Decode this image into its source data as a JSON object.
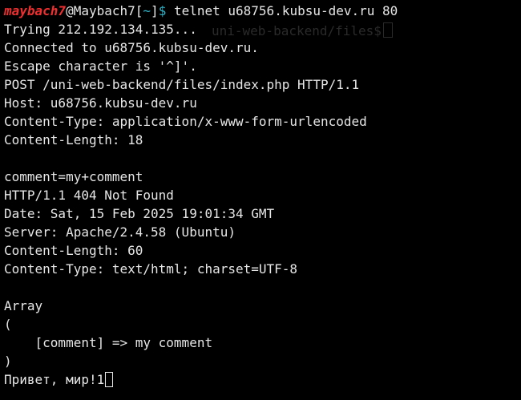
{
  "colors": {
    "background": "#000000",
    "text": "#e6e6e6",
    "prompt_user": "#ef2f2f",
    "prompt_cwd": "#2fb4c8"
  },
  "prompt": {
    "user": "maybach7",
    "at": "@",
    "host": "Maybach7",
    "open_bracket": "[",
    "cwd": "~",
    "close_bracket": "]",
    "symbol": "$",
    "command": " telnet u68756.kubsu-dev.ru 80"
  },
  "ghost_text": "uni-web-backend/files$",
  "output_lines": [
    "Trying 212.192.134.135...",
    "Connected to u68756.kubsu-dev.ru.",
    "Escape character is '^]'.",
    "POST /uni-web-backend/files/index.php HTTP/1.1",
    "Host: u68756.kubsu-dev.ru",
    "Content-Type: application/x-www-form-urlencoded",
    "Content-Length: 18",
    "",
    "comment=my+comment",
    "HTTP/1.1 404 Not Found",
    "Date: Sat, 15 Feb 2025 19:01:34 GMT",
    "Server: Apache/2.4.58 (Ubuntu)",
    "Content-Length: 60",
    "Content-Type: text/html; charset=UTF-8",
    "",
    "Array",
    "(",
    "    [comment] => my comment",
    ")"
  ],
  "last_line": "Привет, мир!1"
}
